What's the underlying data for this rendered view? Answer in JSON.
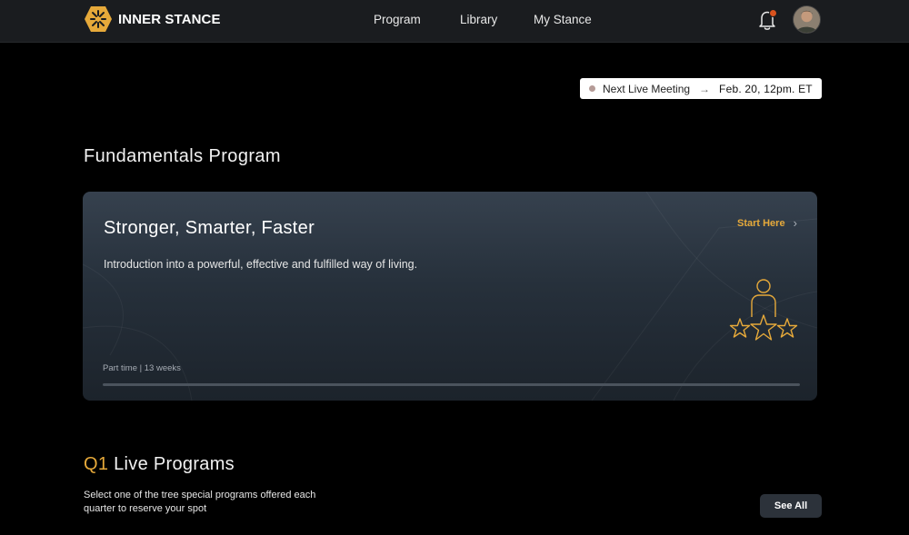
{
  "header": {
    "brand": "INNER STANCE",
    "nav": [
      {
        "label": "Program"
      },
      {
        "label": "Library"
      },
      {
        "label": "My Stance"
      }
    ],
    "notification_icon": "bell-icon",
    "has_unread_notification": true,
    "accent_color": "#e6a93a"
  },
  "live_meeting": {
    "label": "Next Live Meeting",
    "arrow": "→",
    "date": "Feb. 20, 12pm. ET"
  },
  "fundamentals": {
    "section_title": "Fundamentals Program",
    "card": {
      "title": "Stronger, Smarter, Faster",
      "description": "Introduction into a powerful, effective and fulfilled way of living.",
      "cta_label": "Start Here",
      "cta_icon": "chevron-right-icon",
      "illustration": "person-with-stars-icon",
      "meta": "Part time | 13 weeks",
      "progress": 0
    }
  },
  "live_programs": {
    "title_prefix": "Q1",
    "title_rest": " Live Programs",
    "description": "Select one of the tree special programs offered each quarter to reserve your spot",
    "see_all_label": "See All"
  }
}
